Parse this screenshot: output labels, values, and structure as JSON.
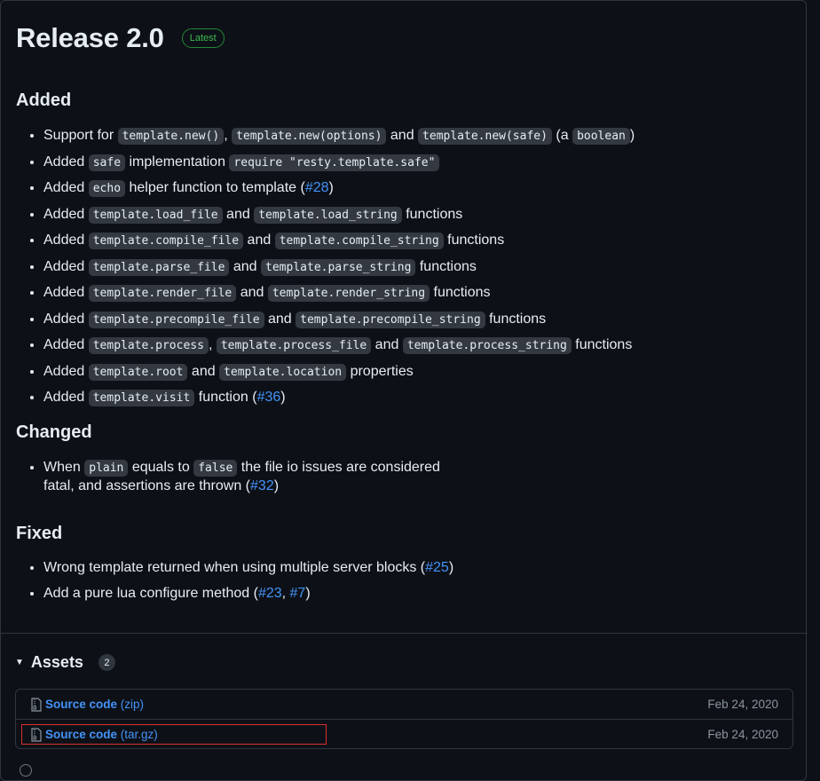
{
  "release": {
    "title": "Release 2.0",
    "badge": "Latest"
  },
  "sections": {
    "added": {
      "heading": "Added",
      "items": [
        [
          {
            "t": "Support for "
          },
          {
            "c": "template.new()"
          },
          {
            "t": ", "
          },
          {
            "c": "template.new(options)"
          },
          {
            "t": " and "
          },
          {
            "c": "template.new(safe)"
          },
          {
            "t": " (a "
          },
          {
            "c": "boolean"
          },
          {
            "t": ")"
          }
        ],
        [
          {
            "t": "Added "
          },
          {
            "c": "safe"
          },
          {
            "t": " implementation "
          },
          {
            "c": "require \"resty.template.safe\""
          }
        ],
        [
          {
            "t": "Added "
          },
          {
            "c": "echo"
          },
          {
            "t": " helper function to template ("
          },
          {
            "l": "#28"
          },
          {
            "t": ")"
          }
        ],
        [
          {
            "t": "Added "
          },
          {
            "c": "template.load_file"
          },
          {
            "t": " and "
          },
          {
            "c": "template.load_string"
          },
          {
            "t": " functions"
          }
        ],
        [
          {
            "t": "Added "
          },
          {
            "c": "template.compile_file"
          },
          {
            "t": " and "
          },
          {
            "c": "template.compile_string"
          },
          {
            "t": " functions"
          }
        ],
        [
          {
            "t": "Added "
          },
          {
            "c": "template.parse_file"
          },
          {
            "t": " and "
          },
          {
            "c": "template.parse_string"
          },
          {
            "t": " functions"
          }
        ],
        [
          {
            "t": "Added "
          },
          {
            "c": "template.render_file"
          },
          {
            "t": " and "
          },
          {
            "c": "template.render_string"
          },
          {
            "t": " functions"
          }
        ],
        [
          {
            "t": "Added "
          },
          {
            "c": "template.precompile_file"
          },
          {
            "t": " and "
          },
          {
            "c": "template.precompile_string"
          },
          {
            "t": " functions"
          }
        ],
        [
          {
            "t": "Added "
          },
          {
            "c": "template.process"
          },
          {
            "t": ", "
          },
          {
            "c": "template.process_file"
          },
          {
            "t": " and "
          },
          {
            "c": "template.process_string"
          },
          {
            "t": " functions"
          }
        ],
        [
          {
            "t": "Added "
          },
          {
            "c": "template.root"
          },
          {
            "t": " and "
          },
          {
            "c": "template.location"
          },
          {
            "t": " properties"
          }
        ],
        [
          {
            "t": "Added "
          },
          {
            "c": "template.visit"
          },
          {
            "t": " function ("
          },
          {
            "l": "#36"
          },
          {
            "t": ")"
          }
        ]
      ]
    },
    "changed": {
      "heading": "Changed",
      "items": [
        [
          {
            "t": "When "
          },
          {
            "c": "plain"
          },
          {
            "t": " equals to "
          },
          {
            "c": "false"
          },
          {
            "t": " the file io issues are considered"
          },
          {
            "br": true
          },
          {
            "t": "fatal, and assertions are thrown ("
          },
          {
            "l": "#32"
          },
          {
            "t": ")"
          }
        ]
      ]
    },
    "fixed": {
      "heading": "Fixed",
      "items": [
        [
          {
            "t": "Wrong template returned when using multiple server blocks ("
          },
          {
            "l": "#25"
          },
          {
            "t": ")"
          }
        ],
        [
          {
            "t": "Add a pure lua configure method ("
          },
          {
            "l": "#23"
          },
          {
            "t": ", "
          },
          {
            "l": "#7"
          },
          {
            "t": ")"
          }
        ]
      ]
    }
  },
  "assets": {
    "title": "Assets",
    "count": "2",
    "toggle_icon": "triangle-down-icon",
    "items": [
      {
        "name": "Source code",
        "suffix": "(zip)",
        "date": "Feb 24, 2020",
        "icon": "file-zip-icon"
      },
      {
        "name": "Source code",
        "suffix": "(tar.gz)",
        "date": "Feb 24, 2020",
        "icon": "file-zip-icon"
      }
    ]
  },
  "colors": {
    "accent": "#4493f8",
    "badge": "#3fb950",
    "highlight": "#d9302f"
  }
}
